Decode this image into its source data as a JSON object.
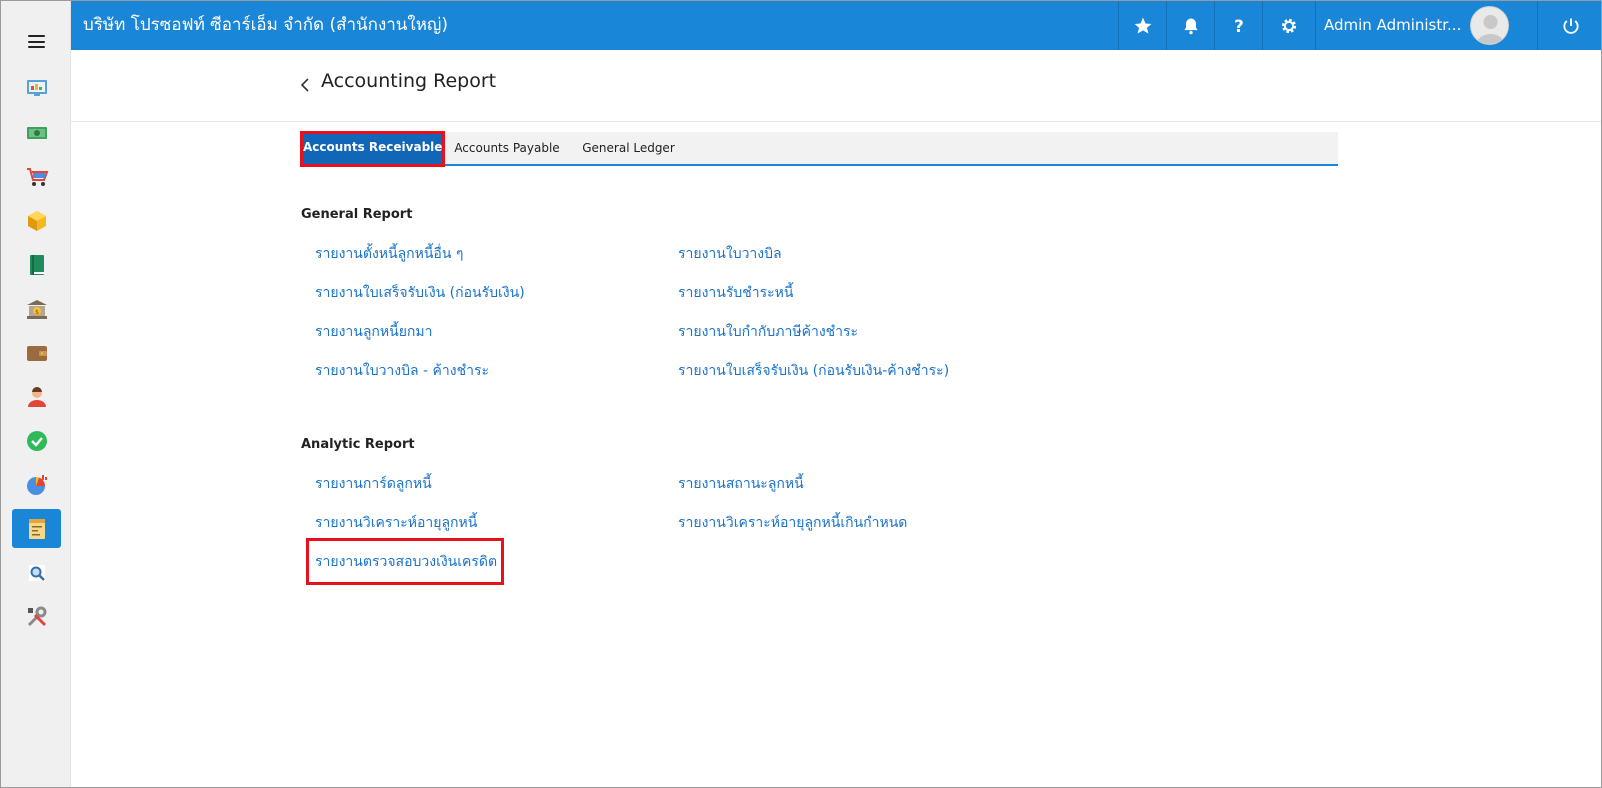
{
  "topbar": {
    "company": "บริษัท โปรซอฟท์ ซีอาร์เอ็ม จำกัด (สำนักงานใหญ่)",
    "user_name": "Admin Administr..."
  },
  "page": {
    "title": "Accounting Report"
  },
  "tabs": [
    {
      "label": "Accounts Receivable",
      "active": true
    },
    {
      "label": "Accounts Payable",
      "active": false
    },
    {
      "label": "General Ledger",
      "active": false
    }
  ],
  "general_report": {
    "title": "General Report",
    "links": [
      "รายงานตั้งหนี้ลูกหนี้อื่น ๆ",
      "รายงานใบวางบิล",
      "รายงานใบเสร็จรับเงิน (ก่อนรับเงิน)",
      "รายงานรับชำระหนี้",
      "รายงานลูกหนี้ยกมา",
      "รายงานใบกำกับภาษีค้างชำระ",
      "รายงานใบวางบิล - ค้างชำระ",
      "รายงานใบเสร็จรับเงิน (ก่อนรับเงิน-ค้างชำระ)"
    ]
  },
  "analytic_report": {
    "title": "Analytic Report",
    "links": [
      "รายงานการ์ดลูกหนี้",
      "รายงานสถานะลูกหนี้",
      "รายงานวิเคราะห์อายุลูกหนี้",
      "รายงานวิเคราะห์อายุลูกหนี้เกินกำหนด",
      "รายงานตรวจสอบวงเงินเครดิต"
    ]
  },
  "colors": {
    "primary": "#1a86d8",
    "tab_active": "#1266b8",
    "link": "#1a73c9",
    "highlight": "#e8101c"
  }
}
